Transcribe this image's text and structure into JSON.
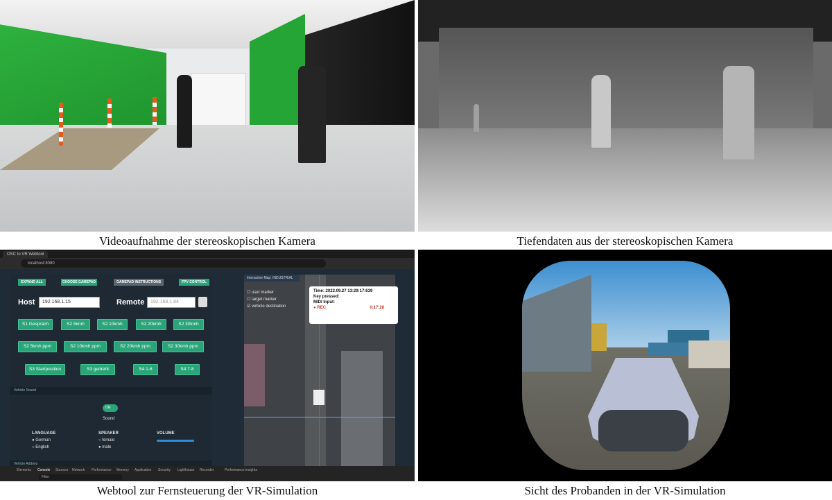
{
  "captions": {
    "top_left": "Videoaufnahme der stereoskopischen Kamera",
    "top_right": "Tiefendaten aus der stereoskopischen Kamera",
    "bottom_left": "Webtool zur Fernsteuerung der VR-Simulation",
    "bottom_right": "Sicht des Probanden in der VR-Simulation"
  },
  "browser": {
    "tab_title": "OSC to VR Webtool",
    "url": "localhost:8080"
  },
  "webtool": {
    "top_buttons": [
      "EXPAND ALL",
      "CHOOSE GAMEPAD",
      "GAMEPAD INSTRUCTIONS",
      "FPV CONTROL"
    ],
    "host_label": "Host",
    "host_value": "192.168.1.15",
    "remote_label": "Remote",
    "remote_placeholder": "192.168.1.84",
    "buttons_row1": [
      "S1 Gespräch",
      "S2 5kmh",
      "S2 10kmh",
      "S2 20kmh",
      "S2 30kmh"
    ],
    "buttons_row2": [
      "S2 5kmh ppm",
      "S2 10kmh ppm",
      "S2 20kmh ppm",
      "S2 30kmh ppm"
    ],
    "buttons_row3": [
      "S3 Startposition",
      "S3 gedreht",
      "S4 1-6",
      "S4 7-8"
    ],
    "section_sound": "Vehicle Sound",
    "toggle_state": "ON",
    "sound_label": "Sound",
    "language_label": "LANGUAGE",
    "language_options": [
      "German",
      "English"
    ],
    "speaker_label": "SPEAKER",
    "speaker_options": [
      "female",
      "male"
    ],
    "volume_label": "VOLUME",
    "section_addons": "Vehicle Addons",
    "map_title": "Interactive Map: INDUSTRIAL",
    "map_checks": [
      "user marker",
      "target marker",
      "vehicle destination"
    ],
    "status": {
      "time": "Time: 2022.09.27 13:29:17:639",
      "key": "Key pressed:",
      "midi": "MIDI Input:",
      "rec": "REC",
      "timer": "0:17:28"
    },
    "devtools_tabs": [
      "Elements",
      "Console",
      "Sources",
      "Network",
      "Performance",
      "Memory",
      "Application",
      "Security",
      "Lighthouse",
      "Recorder",
      "Performance insights"
    ],
    "devtools_filter": "Filter"
  },
  "colors": {
    "app_bg": "#1f2b36",
    "button_green": "#2aa57a",
    "rec_red": "#d9342b"
  }
}
